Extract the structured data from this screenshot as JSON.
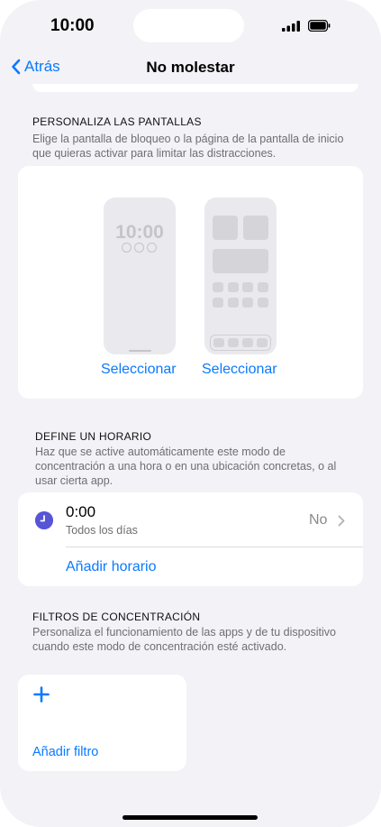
{
  "status_bar": {
    "time": "10:00",
    "icons": [
      "signal-icon",
      "battery-icon"
    ]
  },
  "nav": {
    "back_label": "Atrás",
    "title": "No molestar"
  },
  "screens_section": {
    "header": "PERSONALIZA LAS PANTALLAS",
    "description": "Elige la pantalla de bloqueo o la página de la pantalla de inicio que quieras activar para limitar las distracciones.",
    "lock_screen_time": "10:00",
    "select_lock_label": "Seleccionar",
    "select_home_label": "Seleccionar"
  },
  "schedule_section": {
    "header": "DEFINE UN HORARIO",
    "description": "Haz que se active automáticamente este modo de concentración a una hora o en una ubicación concretas, o al usar cierta app.",
    "row": {
      "time": "0:00",
      "subtitle": "Todos los días",
      "status": "No"
    },
    "add_label": "Añadir horario"
  },
  "filters_section": {
    "header": "FILTROS DE CONCENTRACIÓN",
    "description": "Personaliza el funcionamiento de las apps y de tu dispositivo cuando este modo de concentración esté activado.",
    "add_label": "Añadir filtro"
  },
  "colors": {
    "accent": "#0a7aff",
    "background": "#f2f2f7",
    "clock_icon": "#5854d6"
  }
}
